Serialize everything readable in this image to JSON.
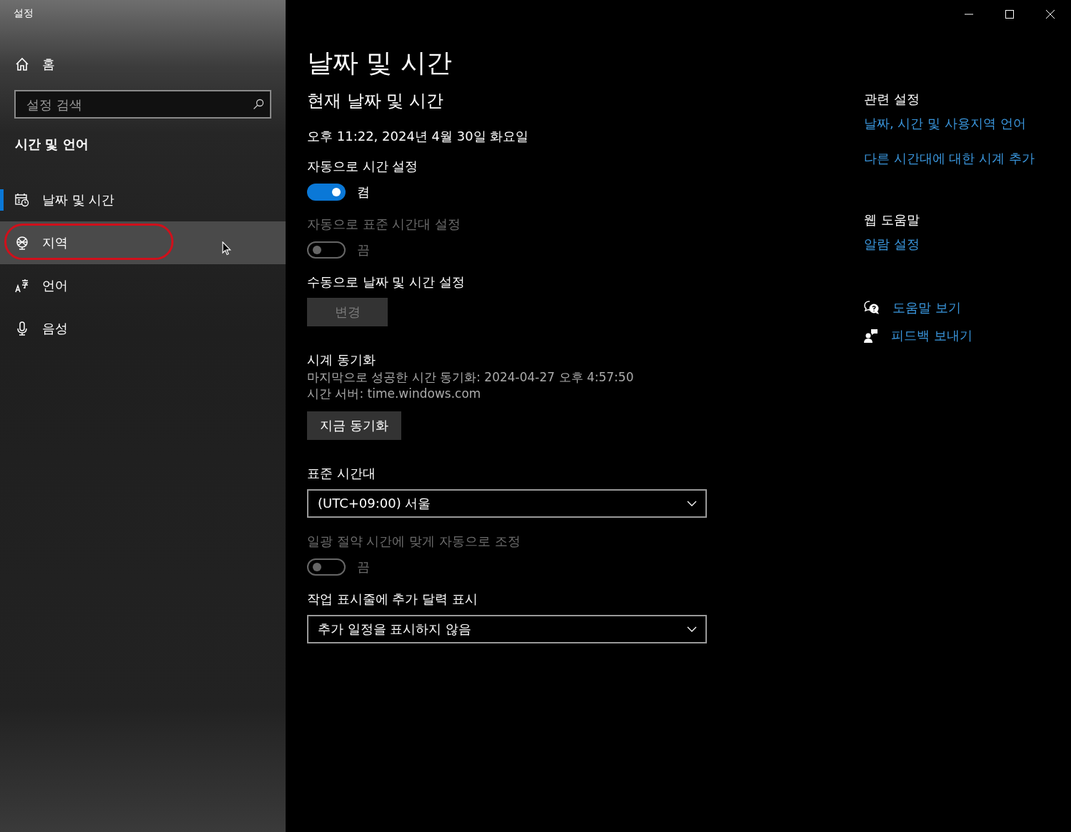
{
  "window": {
    "title": "설정"
  },
  "sidebar": {
    "home": "홈",
    "search": {
      "placeholder": "설정 검색"
    },
    "section_title": "시간 및 언어",
    "items": [
      {
        "label": "날짜 및 시간",
        "kind": "calendar",
        "selected": true,
        "hovered": false,
        "circled": false
      },
      {
        "label": "지역",
        "kind": "globe",
        "selected": false,
        "hovered": true,
        "circled": true
      },
      {
        "label": "언어",
        "kind": "language",
        "selected": false,
        "hovered": false,
        "circled": false
      },
      {
        "label": "음성",
        "kind": "microphone",
        "selected": false,
        "hovered": false,
        "circled": false
      }
    ]
  },
  "main": {
    "title": "날짜 및 시간",
    "subtitle": "현재 날짜 및 시간",
    "current_time": "오후 11:22, 2024년 4월 30일 화요일",
    "settings": [
      {
        "kind": "toggle",
        "label": "자동으로 시간 설정",
        "on": true,
        "disabled": false,
        "state_text": "켬"
      },
      {
        "kind": "toggle",
        "label": "자동으로 표준 시간대 설정",
        "on": false,
        "disabled": true,
        "state_text": "끔"
      },
      {
        "kind": "button",
        "label": "수동으로 날짜 및 시간 설정",
        "button": "변경",
        "disabled": true
      },
      {
        "kind": "sync",
        "label": "시계 동기화",
        "lines": [
          "마지막으로 성공한 시간 동기화: 2024-04-27 오후 4:57:50",
          "시간 서버: time.windows.com"
        ],
        "button": "지금 동기화",
        "disabled": false
      },
      {
        "kind": "dropdown",
        "label": "표준 시간대",
        "value": "(UTC+09:00) 서울"
      },
      {
        "kind": "toggle",
        "label": "일광 절약 시간에 맞게 자동으로 조정",
        "on": false,
        "disabled": true,
        "state_text": "끔"
      },
      {
        "kind": "dropdown",
        "label": "작업 표시줄에 추가 달력 표시",
        "value": "추가 일정을 표시하지 않음"
      }
    ]
  },
  "related": {
    "heading": "관련 설정",
    "links": [
      "날짜, 시간 및 사용지역 언어",
      "다른 시간대에 대한 시계 추가"
    ]
  },
  "web_help": {
    "heading": "웹 도움말",
    "links": [
      "알람 설정"
    ]
  },
  "help_links": [
    {
      "kind": "help",
      "label": "도움말 보기"
    },
    {
      "kind": "feedback",
      "label": "피드백 보내기"
    }
  ]
}
